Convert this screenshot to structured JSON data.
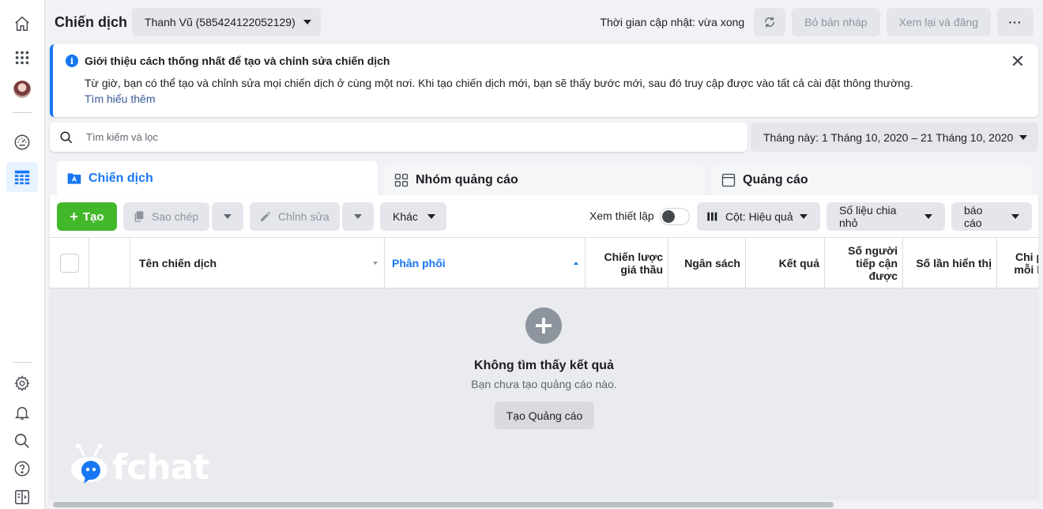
{
  "rail": {
    "icons": [
      "home-icon",
      "apps-grid-icon",
      "avatar",
      "dashboard-gauge-icon",
      "campaigns-table-icon",
      "settings-gear-icon",
      "notifications-bell-icon",
      "search-icon",
      "help-icon",
      "side-panel-icon"
    ]
  },
  "header": {
    "title": "Chiến dịch",
    "account": "Thanh Vũ (585424122052129)",
    "update_status": "Thời gian cập nhật: vừa xong",
    "discard_label": "Bỏ bản nháp",
    "review_publish_label": "Xem lại và đăng",
    "more_label": "···"
  },
  "banner": {
    "title": "Giới thiệu cách thống nhất để tạo và chỉnh sửa chiến dịch",
    "body": "Từ giờ, bạn có thể tạo và chỉnh sửa mọi chiến dịch ở cùng một nơi. Khi tạo chiến dịch mới, bạn sẽ thấy bước mới, sau đó truy cập được vào tất cả cài đặt thông thường.",
    "link": "Tìm hiểu thêm",
    "accent_color": "#1877f2"
  },
  "search": {
    "placeholder": "Tìm kiếm và lọc"
  },
  "date_range": {
    "label": "Tháng này: 1 Tháng 10, 2020 – 21 Tháng 10, 2020"
  },
  "tabs": [
    {
      "label": "Chiến dịch",
      "active": true
    },
    {
      "label": "Nhóm quảng cáo",
      "active": false
    },
    {
      "label": "Quảng cáo",
      "active": false
    }
  ],
  "toolbar": {
    "create_label": "Tạo",
    "copy_label": "Sao chép",
    "edit_label": "Chỉnh sửa",
    "other_label": "Khác",
    "preview_setup_label": "Xem thiết lập",
    "preview_toggle_on": false,
    "columns_label": "Cột: Hiệu quả",
    "breakdown_label": "Số liệu chia nhỏ",
    "reports_label": "báo cáo",
    "create_color": "#42b72a"
  },
  "table": {
    "columns": {
      "name": "Tên chiến dịch",
      "delivery": "Phân phối",
      "bid_strategy_1": "Chiến lược",
      "bid_strategy_2": "giá thầu",
      "budget": "Ngân sách",
      "results": "Kết quả",
      "reach_1": "Số người",
      "reach_2": "tiếp cận",
      "reach_3": "được",
      "impressions": "Số lần hiển thị",
      "cost_1": "Chi p",
      "cost_2": "mỗi k"
    }
  },
  "empty_state": {
    "title": "Không tìm thấy kết quả",
    "subtitle": "Bạn chưa tạo quảng cáo nào.",
    "button": "Tạo Quảng cáo"
  },
  "watermark": {
    "text": "fchat"
  }
}
